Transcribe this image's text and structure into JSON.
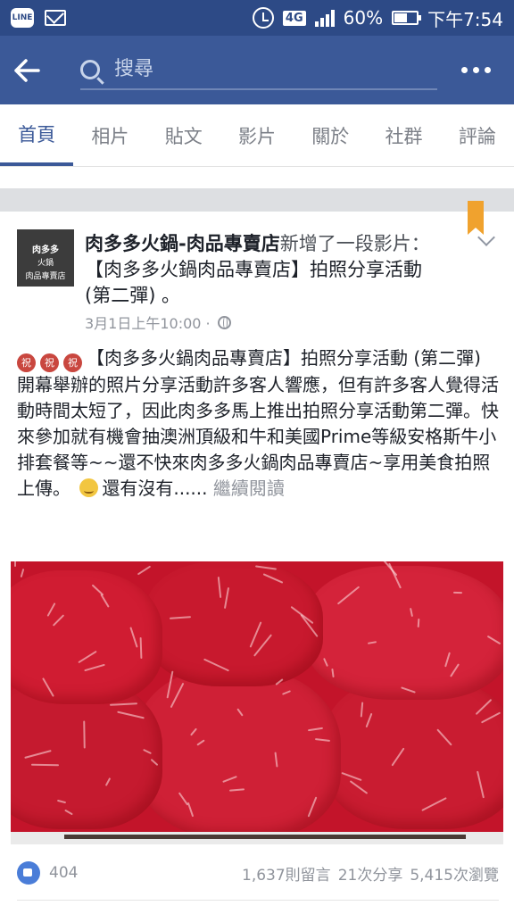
{
  "status_bar": {
    "line_label": "LINE",
    "network": "4G",
    "battery": "60%",
    "battery_level": 0.6,
    "time": "下午7:54"
  },
  "app_bar": {
    "search_placeholder": "搜尋"
  },
  "tabs": [
    {
      "label": "首頁",
      "active": true
    },
    {
      "label": "相片",
      "active": false
    },
    {
      "label": "貼文",
      "active": false
    },
    {
      "label": "影片",
      "active": false
    },
    {
      "label": "關於",
      "active": false
    },
    {
      "label": "社群",
      "active": false
    },
    {
      "label": "評論",
      "active": false
    }
  ],
  "post": {
    "avatar_text": "肉多多",
    "avatar_sub": "火鍋",
    "avatar_sub2": "肉品專賣店",
    "page_name": "肉多多火鍋-肉品專賣店",
    "verb": "新增了一段影片：",
    "title": "【肉多多火鍋肉品專賣店】拍照分享活動 (第二彈) 。",
    "timestamp": "3月1日上午10:00 ·",
    "emoji_1": "祝",
    "emoji_2": "祝",
    "emoji_3": "祝",
    "body_title": "【肉多多火鍋肉品專賣店】拍照分享活動 (第二彈)",
    "body_text": "開幕舉辦的照片分享活動許多客人響應，但有許多客人覺得活動時間太短了，因此肉多多馬上推出拍照分享活動第二彈。快來參加就有機會抽澳洲頂級和牛和美國Prime等級安格斯牛小排套餐等~~還不快來肉多多火鍋肉品專賣店~享用美食拍照上傳。",
    "body_tail": "還有沒有......",
    "see_more": "繼續閱讀"
  },
  "stats": {
    "likes": "404",
    "comments": "1,637則留言",
    "shares": "21次分享",
    "views": "5,415次瀏覽"
  },
  "colors": {
    "status_bar": "#2d4a86",
    "app_bar": "#3b5998",
    "accent": "#3b5998",
    "bookmark": "#f0a22e",
    "meat": "#c3142a"
  }
}
